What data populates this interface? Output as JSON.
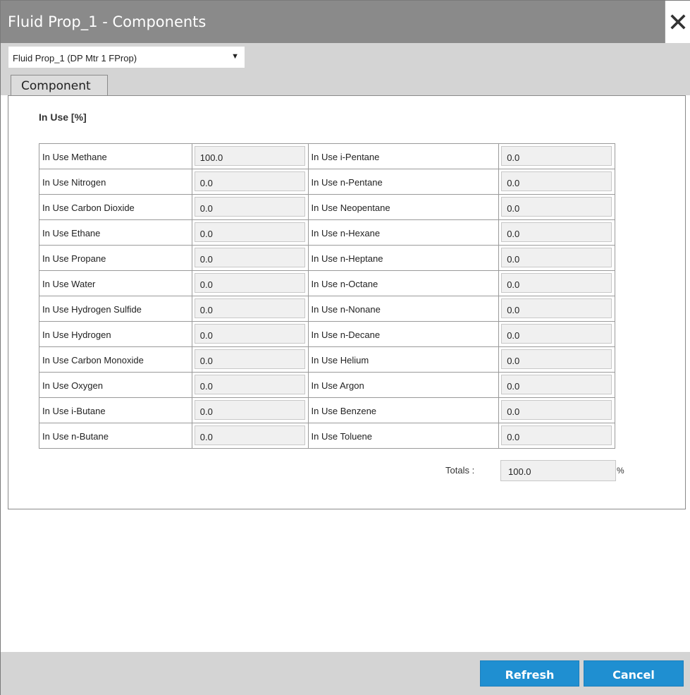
{
  "window": {
    "title": "Fluid Prop_1 - Components"
  },
  "fluid_select": {
    "value": "Fluid Prop_1 (DP Mtr 1 FProp)"
  },
  "tabs": [
    {
      "label": "Component",
      "active": true
    }
  ],
  "section": {
    "title": "In Use [%]"
  },
  "rows": [
    {
      "left_label": "In Use Methane",
      "left_value": "100.0",
      "right_label": "In Use i-Pentane",
      "right_value": "0.0"
    },
    {
      "left_label": "In Use Nitrogen",
      "left_value": "0.0",
      "right_label": "In Use n-Pentane",
      "right_value": "0.0"
    },
    {
      "left_label": "In Use Carbon Dioxide",
      "left_value": "0.0",
      "right_label": "In Use Neopentane",
      "right_value": "0.0"
    },
    {
      "left_label": "In Use Ethane",
      "left_value": "0.0",
      "right_label": "In Use n-Hexane",
      "right_value": "0.0"
    },
    {
      "left_label": "In Use Propane",
      "left_value": "0.0",
      "right_label": "In Use n-Heptane",
      "right_value": "0.0"
    },
    {
      "left_label": "In Use Water",
      "left_value": "0.0",
      "right_label": "In Use n-Octane",
      "right_value": "0.0"
    },
    {
      "left_label": "In Use Hydrogen Sulfide",
      "left_value": "0.0",
      "right_label": "In Use n-Nonane",
      "right_value": "0.0"
    },
    {
      "left_label": "In Use Hydrogen",
      "left_value": "0.0",
      "right_label": "In Use n-Decane",
      "right_value": "0.0"
    },
    {
      "left_label": "In Use Carbon Monoxide",
      "left_value": "0.0",
      "right_label": "In Use Helium",
      "right_value": "0.0"
    },
    {
      "left_label": "In Use Oxygen",
      "left_value": "0.0",
      "right_label": "In Use Argon",
      "right_value": "0.0"
    },
    {
      "left_label": "In Use i-Butane",
      "left_value": "0.0",
      "right_label": "In Use Benzene",
      "right_value": "0.0"
    },
    {
      "left_label": "In Use n-Butane",
      "left_value": "0.0",
      "right_label": "In Use Toluene",
      "right_value": "0.0"
    }
  ],
  "totals": {
    "label": "Totals :",
    "value": "100.0",
    "unit": "%"
  },
  "buttons": {
    "refresh": "Refresh",
    "cancel": "Cancel"
  },
  "colors": {
    "titlebar": "#8a8a8a",
    "toolbar": "#d4d4d4",
    "button": "#1f8fd1",
    "input_bg": "#f0f0f0"
  },
  "icons": {
    "close": "close-icon",
    "dropdown": "chevron-down-icon"
  }
}
